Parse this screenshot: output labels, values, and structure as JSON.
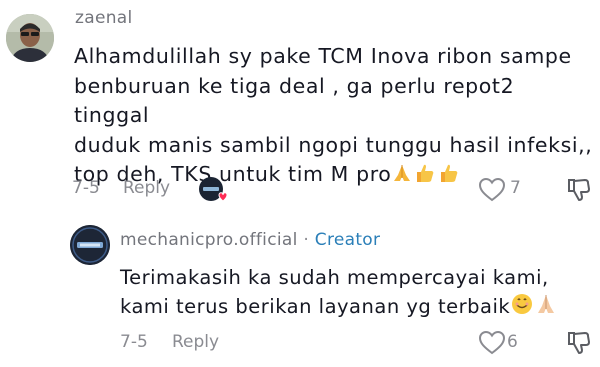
{
  "comment": {
    "username": "zaenal",
    "text_line1": "Alhamdulillah sy pake TCM Inova ribon sampe",
    "text_line2": "benburuan ke tiga deal , ga perlu repot2 tinggal",
    "text_line3": "duduk manis sambil ngopi tunggu hasil infeksi,,",
    "text_line4": "top deh, TKS untuk tim M pro",
    "emojis": [
      "folded-hands",
      "thumbs-up",
      "thumbs-up"
    ],
    "date": "7-5",
    "reply_label": "Reply",
    "like_count": "7"
  },
  "reply": {
    "username": "mechanicpro.official",
    "separator": "·",
    "badge": "Creator",
    "text_line1": "Terimakasih ka sudah mempercayai kami,",
    "text_line2": "kami terus berikan layanan yg terbaik",
    "emojis": [
      "smiling-face",
      "folded-hands"
    ],
    "date": "7-5",
    "reply_label": "Reply",
    "like_count": "6"
  },
  "colors": {
    "text": "#161823",
    "meta": "#8a8b91",
    "creator": "#2b7fb8",
    "heart": "#fe2c55"
  }
}
